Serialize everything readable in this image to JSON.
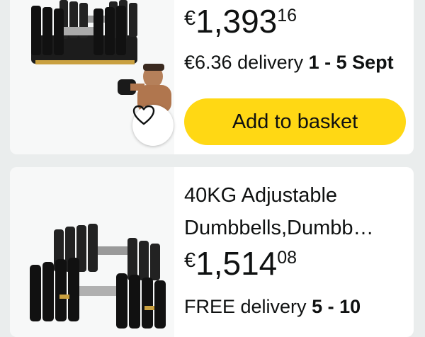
{
  "products": [
    {
      "price": {
        "currency": "€",
        "whole": "1,393",
        "fraction": "16"
      },
      "delivery": {
        "text": "€6.36 delivery ",
        "dates": "1 - 5 Sept"
      },
      "add_to_basket_label": "Add to basket",
      "icons": {
        "wishlist": "heart-outline-icon"
      }
    },
    {
      "title_line1": "40KG Adjustable",
      "title_line2": "Dumbbells,Dumbb…",
      "price": {
        "currency": "€",
        "whole": "1,514",
        "fraction": "08"
      },
      "delivery": {
        "text": "FREE delivery ",
        "dates": "5 - 10"
      }
    }
  ],
  "colors": {
    "page_bg": "#eaeded",
    "card_bg": "#ffffff",
    "button_yellow": "#ffd814",
    "text": "#0f1111"
  }
}
